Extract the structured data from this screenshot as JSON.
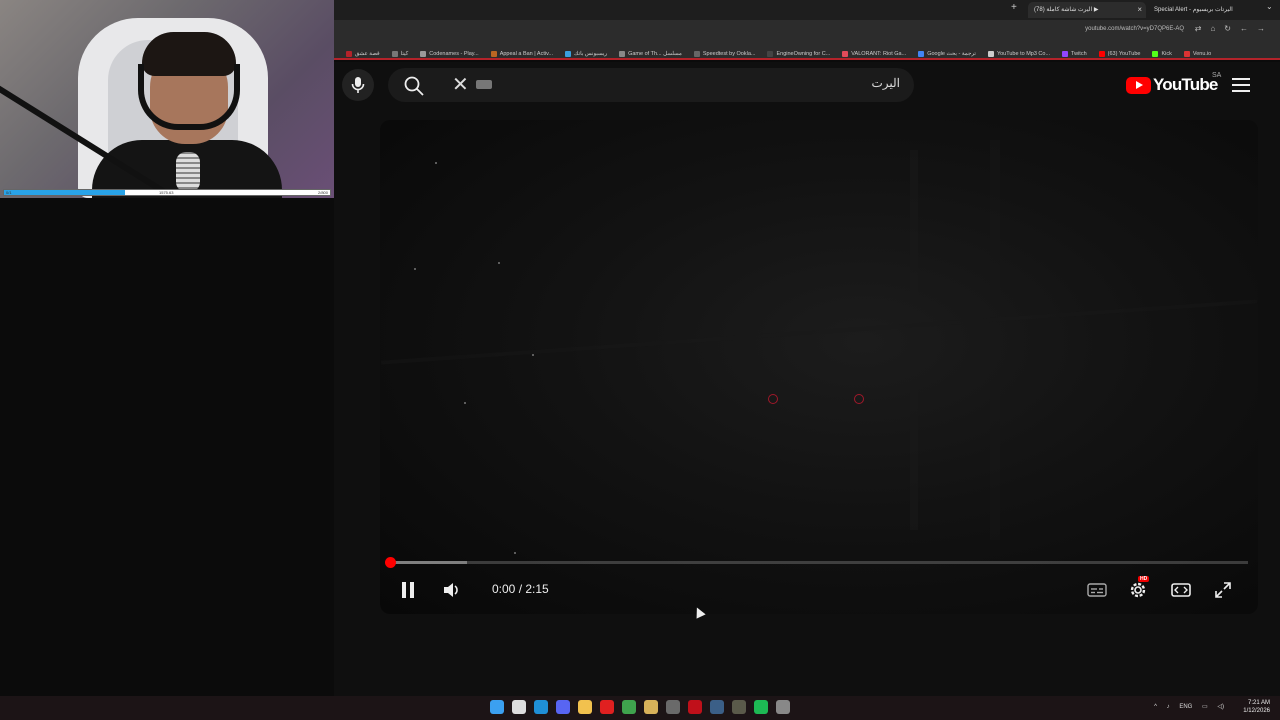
{
  "browser": {
    "tabs": [
      {
        "title": "اليرت شاشة كاملة (78) ▶",
        "active": true
      },
      {
        "title": "Special Alert - اليرتات بريسيوم",
        "active": false
      }
    ],
    "url": "youtube.com/watch?v=yD7QP6E-AQ"
  },
  "bookmarks": [
    {
      "label": "قصة عشق",
      "color": "#b3232a"
    },
    {
      "label": "كيتا",
      "color": "#777777"
    },
    {
      "label": "Codenames - Play...",
      "color": "#999999"
    },
    {
      "label": "Appeal a Ban | Activ...",
      "color": "#bb6622"
    },
    {
      "label": "ريسبونس باتك",
      "color": "#3aa0e0"
    },
    {
      "label": "Game of Th... مسلسل",
      "color": "#888888"
    },
    {
      "label": "Speedtest by Ookla...",
      "color": "#666666"
    },
    {
      "label": "EngineOwning for C...",
      "color": "#444444"
    },
    {
      "label": "VALORANT: Riot Ga...",
      "color": "#e14b5a"
    },
    {
      "label": "Google ترجمة - بحث",
      "color": "#4285f4"
    },
    {
      "label": "YouTube to Mp3 Co...",
      "color": "#cccccc"
    },
    {
      "label": "Twitch",
      "color": "#9146ff"
    },
    {
      "label": "(63) YouTube",
      "color": "#ff0000"
    },
    {
      "label": "Kick",
      "color": "#53fc18"
    },
    {
      "label": "Venu.io",
      "color": "#dd3333"
    }
  ],
  "webcam": {
    "bar_left": "0/1",
    "bar_mid": "1575.63",
    "bar_right": "2/800",
    "bar_fill": 0.37
  },
  "youtube": {
    "search_query": "اليرت",
    "logo_text": "YouTube",
    "country_code": "SA"
  },
  "player": {
    "current_time": "0:00",
    "separator": " / ",
    "duration": "2:15",
    "played_fraction": 0.0,
    "buffered_fraction": 0.09,
    "hd_badge": "HD"
  },
  "taskbar": {
    "language": "ENG",
    "time": "7:21 AM",
    "date": "1/12/2026",
    "apps": [
      {
        "name": "windows-start",
        "color": "#3ba0f0"
      },
      {
        "name": "task-view",
        "color": "#dddddd"
      },
      {
        "name": "edge",
        "color": "#1f8fd6"
      },
      {
        "name": "discord",
        "color": "#5865f2"
      },
      {
        "name": "file-explorer",
        "color": "#f2c14e"
      },
      {
        "name": "youtube-app",
        "color": "#e02020"
      },
      {
        "name": "xbox",
        "color": "#3fa34d"
      },
      {
        "name": "app-yellow",
        "color": "#d8b25a"
      },
      {
        "name": "app-obs",
        "color": "#6a6a6a"
      },
      {
        "name": "netflix",
        "color": "#c0101a"
      },
      {
        "name": "steam",
        "color": "#3b5f87"
      },
      {
        "name": "app-media",
        "color": "#5a5a4a"
      },
      {
        "name": "spotify",
        "color": "#1db954"
      },
      {
        "name": "chrome",
        "color": "#888888"
      }
    ]
  }
}
